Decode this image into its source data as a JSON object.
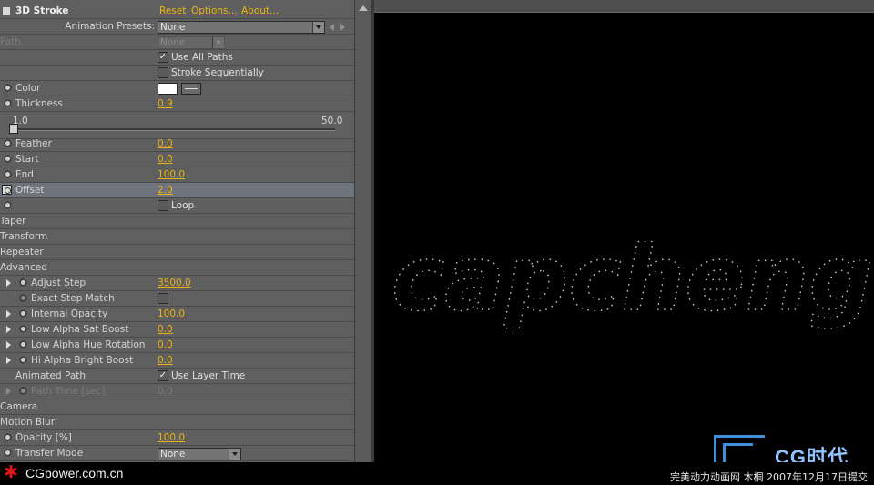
{
  "effect": {
    "title": "3D Stroke",
    "reset": "Reset",
    "options": "Options...",
    "about": "About...",
    "animation_presets_label": "Animation Presets:",
    "animation_presets_value": "None"
  },
  "params": {
    "path_label": "Path",
    "path_value": "None",
    "use_all_paths": "Use All Paths",
    "stroke_sequentially": "Stroke Sequentially",
    "color": "Color",
    "thickness": "Thickness",
    "thickness_value": "0.9",
    "thickness_min": "1.0",
    "thickness_max": "50.0",
    "thickness_slider_fraction": 0,
    "feather": "Feather",
    "feather_value": "0.0",
    "start": "Start",
    "start_value": "0.0",
    "end": "End",
    "end_value": "100.0",
    "offset": "Offset",
    "offset_value": "2.0",
    "loop": "Loop"
  },
  "groups": {
    "taper": "Taper",
    "transform": "Transform",
    "repeater": "Repeater",
    "advanced": "Advanced",
    "camera": "Camera",
    "motion_blur": "Motion Blur"
  },
  "advanced": {
    "adjust_step": "Adjust Step",
    "adjust_step_value": "3500.0",
    "exact_step_match": "Exact Step Match",
    "internal_opacity": "Internal Opacity",
    "internal_opacity_value": "100.0",
    "low_alpha_sat_boost": "Low Alpha Sat Boost",
    "low_alpha_sat_boost_value": "0.0",
    "low_alpha_hue_rotation": "Low Alpha Hue Rotation",
    "low_alpha_hue_rotation_value": "0.0",
    "hi_alpha_bright_boost": "Hi Alpha Bright Boost",
    "hi_alpha_bright_boost_value": "0.0",
    "animated_path": "Animated Path",
    "use_layer_time": "Use Layer Time",
    "path_time": "Path Time [sec]",
    "path_time_value": "0.0"
  },
  "bottom": {
    "opacity": "Opacity [%]",
    "opacity_value": "100.0",
    "transfer_mode": "Transfer Mode",
    "transfer_mode_value": "None"
  },
  "viewer": {
    "text": "capcheng"
  },
  "footer": {
    "site": "CGpower.com.cn",
    "credit": "完美动力动画网 木桐 2007年12月17日提交",
    "logo": "CG时代"
  },
  "colors": {
    "accent": "#e8b418",
    "panel": "#5f5f5f",
    "stroke_color": "#ffffff"
  }
}
